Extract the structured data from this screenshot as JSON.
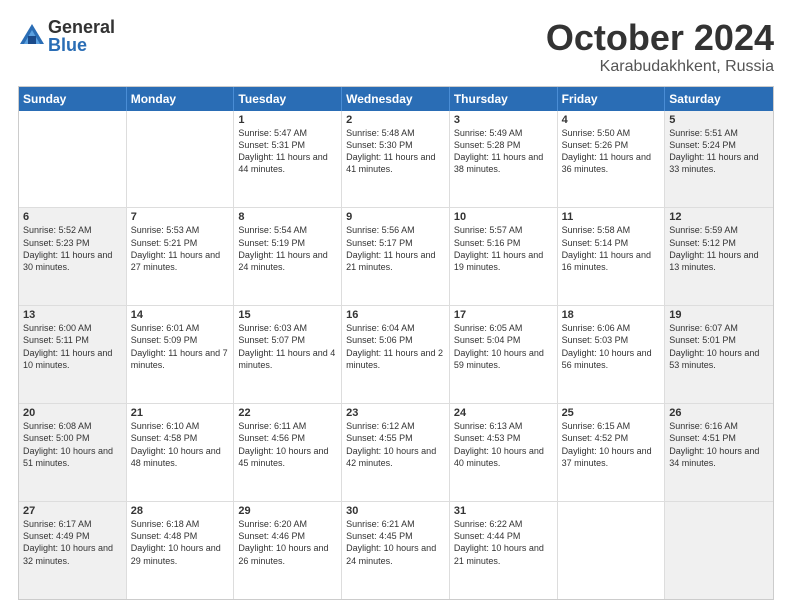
{
  "logo": {
    "general": "General",
    "blue": "Blue"
  },
  "title": "October 2024",
  "location": "Karabudakhkent, Russia",
  "header_days": [
    "Sunday",
    "Monday",
    "Tuesday",
    "Wednesday",
    "Thursday",
    "Friday",
    "Saturday"
  ],
  "weeks": [
    [
      {
        "day": "",
        "info": "",
        "shaded": false
      },
      {
        "day": "",
        "info": "",
        "shaded": false
      },
      {
        "day": "1",
        "info": "Sunrise: 5:47 AM\nSunset: 5:31 PM\nDaylight: 11 hours and 44 minutes.",
        "shaded": false
      },
      {
        "day": "2",
        "info": "Sunrise: 5:48 AM\nSunset: 5:30 PM\nDaylight: 11 hours and 41 minutes.",
        "shaded": false
      },
      {
        "day": "3",
        "info": "Sunrise: 5:49 AM\nSunset: 5:28 PM\nDaylight: 11 hours and 38 minutes.",
        "shaded": false
      },
      {
        "day": "4",
        "info": "Sunrise: 5:50 AM\nSunset: 5:26 PM\nDaylight: 11 hours and 36 minutes.",
        "shaded": false
      },
      {
        "day": "5",
        "info": "Sunrise: 5:51 AM\nSunset: 5:24 PM\nDaylight: 11 hours and 33 minutes.",
        "shaded": true
      }
    ],
    [
      {
        "day": "6",
        "info": "Sunrise: 5:52 AM\nSunset: 5:23 PM\nDaylight: 11 hours and 30 minutes.",
        "shaded": true
      },
      {
        "day": "7",
        "info": "Sunrise: 5:53 AM\nSunset: 5:21 PM\nDaylight: 11 hours and 27 minutes.",
        "shaded": false
      },
      {
        "day": "8",
        "info": "Sunrise: 5:54 AM\nSunset: 5:19 PM\nDaylight: 11 hours and 24 minutes.",
        "shaded": false
      },
      {
        "day": "9",
        "info": "Sunrise: 5:56 AM\nSunset: 5:17 PM\nDaylight: 11 hours and 21 minutes.",
        "shaded": false
      },
      {
        "day": "10",
        "info": "Sunrise: 5:57 AM\nSunset: 5:16 PM\nDaylight: 11 hours and 19 minutes.",
        "shaded": false
      },
      {
        "day": "11",
        "info": "Sunrise: 5:58 AM\nSunset: 5:14 PM\nDaylight: 11 hours and 16 minutes.",
        "shaded": false
      },
      {
        "day": "12",
        "info": "Sunrise: 5:59 AM\nSunset: 5:12 PM\nDaylight: 11 hours and 13 minutes.",
        "shaded": true
      }
    ],
    [
      {
        "day": "13",
        "info": "Sunrise: 6:00 AM\nSunset: 5:11 PM\nDaylight: 11 hours and 10 minutes.",
        "shaded": true
      },
      {
        "day": "14",
        "info": "Sunrise: 6:01 AM\nSunset: 5:09 PM\nDaylight: 11 hours and 7 minutes.",
        "shaded": false
      },
      {
        "day": "15",
        "info": "Sunrise: 6:03 AM\nSunset: 5:07 PM\nDaylight: 11 hours and 4 minutes.",
        "shaded": false
      },
      {
        "day": "16",
        "info": "Sunrise: 6:04 AM\nSunset: 5:06 PM\nDaylight: 11 hours and 2 minutes.",
        "shaded": false
      },
      {
        "day": "17",
        "info": "Sunrise: 6:05 AM\nSunset: 5:04 PM\nDaylight: 10 hours and 59 minutes.",
        "shaded": false
      },
      {
        "day": "18",
        "info": "Sunrise: 6:06 AM\nSunset: 5:03 PM\nDaylight: 10 hours and 56 minutes.",
        "shaded": false
      },
      {
        "day": "19",
        "info": "Sunrise: 6:07 AM\nSunset: 5:01 PM\nDaylight: 10 hours and 53 minutes.",
        "shaded": true
      }
    ],
    [
      {
        "day": "20",
        "info": "Sunrise: 6:08 AM\nSunset: 5:00 PM\nDaylight: 10 hours and 51 minutes.",
        "shaded": true
      },
      {
        "day": "21",
        "info": "Sunrise: 6:10 AM\nSunset: 4:58 PM\nDaylight: 10 hours and 48 minutes.",
        "shaded": false
      },
      {
        "day": "22",
        "info": "Sunrise: 6:11 AM\nSunset: 4:56 PM\nDaylight: 10 hours and 45 minutes.",
        "shaded": false
      },
      {
        "day": "23",
        "info": "Sunrise: 6:12 AM\nSunset: 4:55 PM\nDaylight: 10 hours and 42 minutes.",
        "shaded": false
      },
      {
        "day": "24",
        "info": "Sunrise: 6:13 AM\nSunset: 4:53 PM\nDaylight: 10 hours and 40 minutes.",
        "shaded": false
      },
      {
        "day": "25",
        "info": "Sunrise: 6:15 AM\nSunset: 4:52 PM\nDaylight: 10 hours and 37 minutes.",
        "shaded": false
      },
      {
        "day": "26",
        "info": "Sunrise: 6:16 AM\nSunset: 4:51 PM\nDaylight: 10 hours and 34 minutes.",
        "shaded": true
      }
    ],
    [
      {
        "day": "27",
        "info": "Sunrise: 6:17 AM\nSunset: 4:49 PM\nDaylight: 10 hours and 32 minutes.",
        "shaded": true
      },
      {
        "day": "28",
        "info": "Sunrise: 6:18 AM\nSunset: 4:48 PM\nDaylight: 10 hours and 29 minutes.",
        "shaded": false
      },
      {
        "day": "29",
        "info": "Sunrise: 6:20 AM\nSunset: 4:46 PM\nDaylight: 10 hours and 26 minutes.",
        "shaded": false
      },
      {
        "day": "30",
        "info": "Sunrise: 6:21 AM\nSunset: 4:45 PM\nDaylight: 10 hours and 24 minutes.",
        "shaded": false
      },
      {
        "day": "31",
        "info": "Sunrise: 6:22 AM\nSunset: 4:44 PM\nDaylight: 10 hours and 21 minutes.",
        "shaded": false
      },
      {
        "day": "",
        "info": "",
        "shaded": false
      },
      {
        "day": "",
        "info": "",
        "shaded": true
      }
    ]
  ]
}
